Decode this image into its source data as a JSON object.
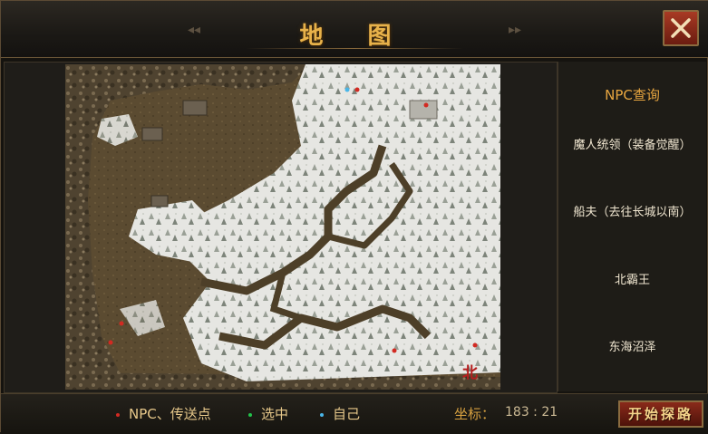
{
  "window": {
    "title": "地  图"
  },
  "npc_panel": {
    "title": "NPC查询",
    "items": [
      {
        "label": "魔人统领（装备觉醒）"
      },
      {
        "label": "船夫（去往长城以南）"
      },
      {
        "label": "北霸王"
      },
      {
        "label": "东海沼泽"
      }
    ]
  },
  "map": {
    "north_label": "北"
  },
  "legend": {
    "npc": {
      "label": "NPC、传送点",
      "color": "#d22a22"
    },
    "selected": {
      "label": "选中",
      "color": "#22c24a"
    },
    "self": {
      "label": "自己",
      "color": "#4ab6e8"
    }
  },
  "coordinates": {
    "label": "坐标：",
    "value": "183 : 21"
  },
  "start_button": {
    "label": "开始探路"
  },
  "colors": {
    "accent": "#e8b24a",
    "snow": "#e6e6e2",
    "earth": "#5a4a30"
  }
}
